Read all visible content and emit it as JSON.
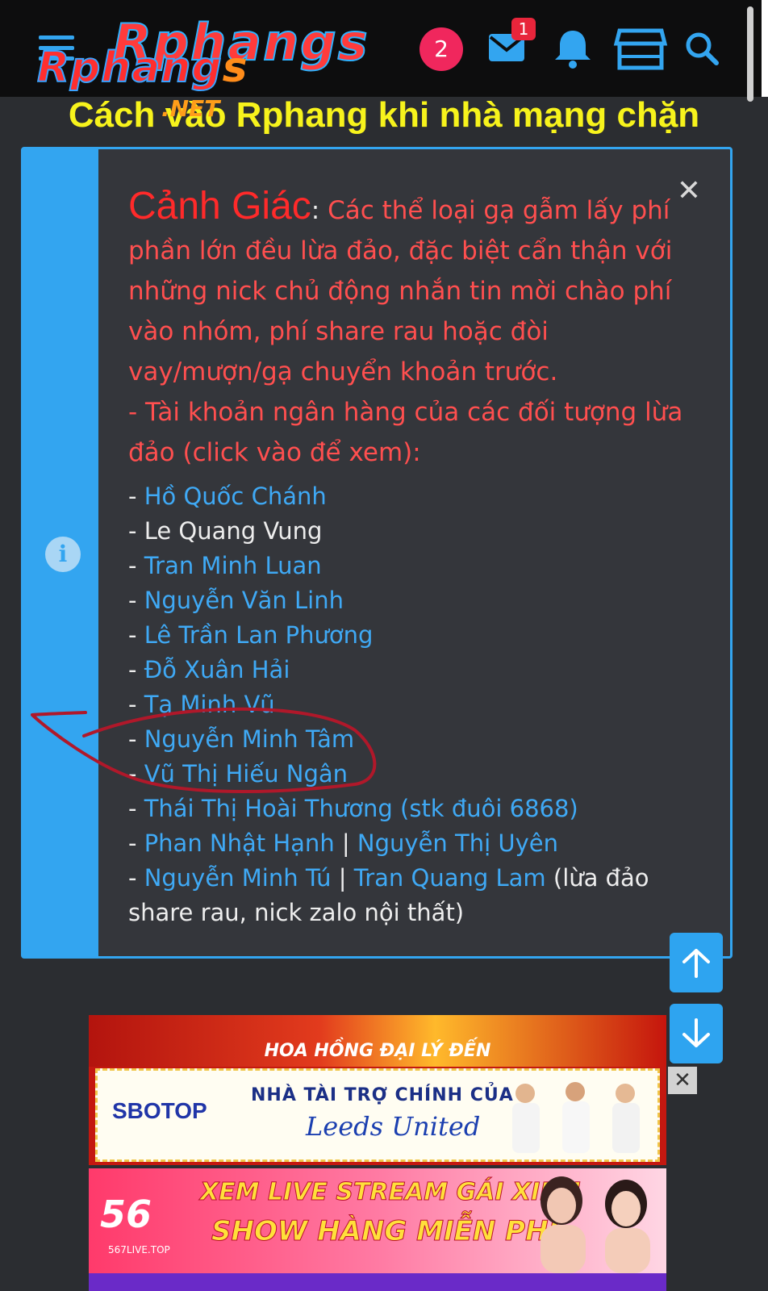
{
  "header": {
    "logo_main": "Rphangs",
    "logo_main_front": "Rphang",
    "logo_s": "s",
    "logo_tld": ".NET",
    "badge_count": "2",
    "mail_count": "1",
    "icons": [
      "menu-icon",
      "mail-icon",
      "bell-icon",
      "store-icon",
      "search-icon"
    ]
  },
  "headline": "Cách vào Rphang khi nhà mạng chặn",
  "alert": {
    "title": "Cảnh Giác",
    "colon": ":",
    "intro": "Các thể loại gạ gẫm lấy phí phần lớn đều lừa đảo, đặc biệt cẩn thận với những nick chủ động nhắn tin mời chào phí vào nhóm, phí share rau hoặc đòi vay/mượn/gạ chuyển khoản trước.",
    "bank_note": "- Tài khoản ngân hàng của các đối tượng lừa đảo (click vào để xem):",
    "dash": "- ",
    "pipe": " | ",
    "names": [
      {
        "text": "Hồ Quốc Chánh",
        "link": true
      },
      {
        "text": "Le Quang Vung",
        "link": false
      },
      {
        "text": "Tran Minh Luan",
        "link": true
      },
      {
        "text": "Nguyễn Văn Linh",
        "link": true
      },
      {
        "text": "Lê Trần Lan Phương",
        "link": true
      },
      {
        "text": "Đỗ Xuân Hải",
        "link": true
      },
      {
        "text": "Tạ Minh Vũ",
        "link": true
      },
      {
        "text": "Nguyễn Minh Tâm",
        "link": true
      },
      {
        "text": "Vũ Thị Hiếu Ngân",
        "link": true
      },
      {
        "text": "Thái Thị Hoài Thương (stk đuôi 6868)",
        "link": true
      }
    ],
    "pair1": [
      "Phan Nhật Hạnh",
      "Nguyễn Thị Uyên"
    ],
    "pair2": [
      "Nguyễn Minh Tú",
      "Tran Quang Lam"
    ],
    "pair2_note": " (lừa đảo share rau, nick zalo nội thất)"
  },
  "ads": {
    "promo_text": "HOA HỒNG ĐẠI LÝ ĐẾN",
    "sponsor_brand": "SBOTOP",
    "sponsor_line": "NHÀ TÀI TRỢ CHÍNH CỦA",
    "sponsor_team": "Leeds United",
    "ad2_logo": "56",
    "ad2_url": "567LIVE.TOP",
    "ad2_line1": "XEM LIVE STREAM GÁI XINH",
    "ad2_line2": "SHOW HÀNG MIỄN PHÍ",
    "close_label": "✕"
  },
  "colors": {
    "accent": "#33a5f0",
    "warning": "#ff4f4f",
    "headline": "#f7f31c",
    "annotation": "#b0182a"
  }
}
